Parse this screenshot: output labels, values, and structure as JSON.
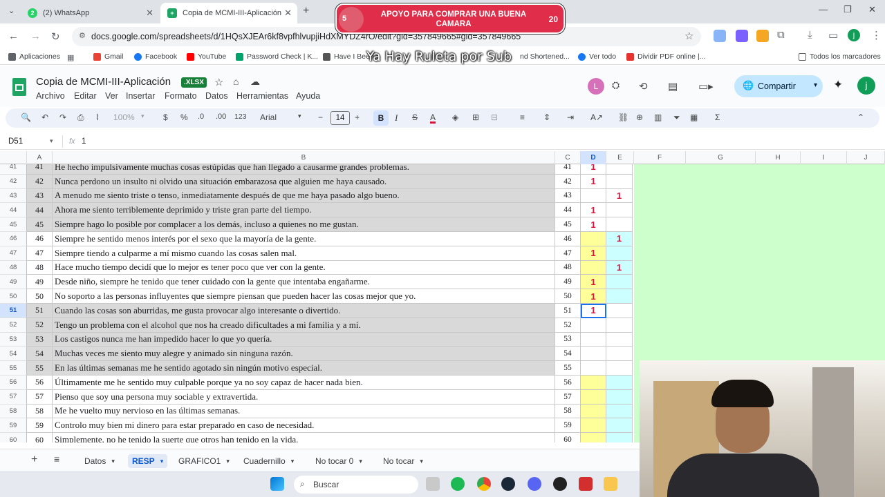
{
  "browser": {
    "tabs": [
      {
        "title": "(2) WhatsApp",
        "badge": "2",
        "active": false
      },
      {
        "title": "Copia de MCMI-III-Aplicación",
        "active": true
      }
    ],
    "url": "docs.google.com/spreadsheets/d/1HQsXJEAr6kf8vpfhlvupjiHdXMYDZ4rO/edit?gid=357849665#gid=357849665",
    "bookmarks": [
      "Aplicaciones",
      "Gmail",
      "Facebook",
      "YouTube",
      "Password Check | K...",
      "Have I Been",
      "Ver todo",
      "Dividir PDF online |...",
      "Todos los marcadores"
    ],
    "bookmark_partial": "nd Shortened..."
  },
  "overlay": {
    "left_number": "5",
    "message": "APOYO PARA COMPRAR UNA BUENA CAMARA",
    "right_number": "20",
    "ruleta_text": "Ya Hay Ruleta por Sub"
  },
  "doc": {
    "title": "Copia de MCMI-III-Aplicación",
    "format_badge": ".XLSX",
    "menus": [
      "Archivo",
      "Editar",
      "Ver",
      "Insertar",
      "Formato",
      "Datos",
      "Herramientas",
      "Ayuda"
    ],
    "share_label": "Compartir",
    "avatar_l": "L",
    "avatar_j": "j"
  },
  "toolbar": {
    "zoom": "100%",
    "currency": "$",
    "percent": "%",
    "dec_less": ".0",
    "dec_more": ".00",
    "number_format": "123",
    "font": "Arial",
    "font_size": "14",
    "bold": "B",
    "italic": "I",
    "strike": "S",
    "text_color": "A",
    "sum": "Σ"
  },
  "formula_bar": {
    "cell_ref": "D51",
    "fx": "fx",
    "value": "1"
  },
  "columns": [
    "A",
    "B",
    "C",
    "D",
    "E",
    "F",
    "G",
    "H",
    "I",
    "J"
  ],
  "rows": [
    {
      "n": "41",
      "a": "41",
      "b": "He hecho impulsivamente muchas cosas estúpidas que han llegado a causarme grandes problemas.",
      "c": "41",
      "d": "1",
      "e": "",
      "shade": true,
      "dbg": "",
      "ebg": ""
    },
    {
      "n": "42",
      "a": "42",
      "b": "Nunca perdono un insulto ni olvido una situación embarazosa que alguien me haya causado.",
      "c": "42",
      "d": "1",
      "e": "",
      "shade": true,
      "dbg": "",
      "ebg": ""
    },
    {
      "n": "43",
      "a": "43",
      "b": "A menudo me siento triste o tenso, inmediatamente después de que me haya pasado algo bueno.",
      "c": "43",
      "d": "",
      "e": "1",
      "shade": true,
      "dbg": "",
      "ebg": ""
    },
    {
      "n": "44",
      "a": "44",
      "b": "Ahora me siento terriblemente deprimido y triste gran parte del tiempo.",
      "c": "44",
      "d": "1",
      "e": "",
      "shade": true,
      "dbg": "",
      "ebg": ""
    },
    {
      "n": "45",
      "a": "45",
      "b": "Siempre hago lo posible por complacer a los demás, incluso a quienes no me gustan.",
      "c": "45",
      "d": "1",
      "e": "",
      "shade": true,
      "dbg": "",
      "ebg": ""
    },
    {
      "n": "46",
      "a": "46",
      "b": "Siempre he sentido menos interés por el sexo que la mayoría de la gente.",
      "c": "46",
      "d": "",
      "e": "1",
      "shade": false,
      "dbg": "yellow",
      "ebg": "cyan"
    },
    {
      "n": "47",
      "a": "47",
      "b": "Siempre tiendo a culparme a mí mismo cuando las cosas salen mal.",
      "c": "47",
      "d": "1",
      "e": "",
      "shade": false,
      "dbg": "yellow",
      "ebg": "cyan"
    },
    {
      "n": "48",
      "a": "48",
      "b": "Hace mucho tiempo decidí que lo mejor es tener poco que ver con la gente.",
      "c": "48",
      "d": "",
      "e": "1",
      "shade": false,
      "dbg": "yellow",
      "ebg": "cyan"
    },
    {
      "n": "49",
      "a": "49",
      "b": "Desde niño, siempre he tenido que tener cuidado con la gente que intentaba engañarme.",
      "c": "49",
      "d": "1",
      "e": "",
      "shade": false,
      "dbg": "yellow",
      "ebg": "cyan"
    },
    {
      "n": "50",
      "a": "50",
      "b": "No soporto a las personas influyentes que siempre piensan que pueden hacer las cosas mejor que yo.",
      "c": "50",
      "d": "1",
      "e": "",
      "shade": false,
      "dbg": "yellow",
      "ebg": "cyan"
    },
    {
      "n": "51",
      "a": "51",
      "b": "Cuando las cosas son aburridas, me gusta provocar algo interesante o divertido.",
      "c": "51",
      "d": "1",
      "e": "",
      "shade": true,
      "dbg": "",
      "ebg": ""
    },
    {
      "n": "52",
      "a": "52",
      "b": "Tengo un problema con el alcohol que nos ha creado dificultades a mi familia y a mí.",
      "c": "52",
      "d": "",
      "e": "",
      "shade": true,
      "dbg": "",
      "ebg": ""
    },
    {
      "n": "53",
      "a": "53",
      "b": "Los castigos nunca me han impedido hacer lo que yo quería.",
      "c": "53",
      "d": "",
      "e": "",
      "shade": true,
      "dbg": "",
      "ebg": ""
    },
    {
      "n": "54",
      "a": "54",
      "b": "Muchas veces me siento muy alegre y animado sin ninguna razón.",
      "c": "54",
      "d": "",
      "e": "",
      "shade": true,
      "dbg": "",
      "ebg": ""
    },
    {
      "n": "55",
      "a": "55",
      "b": "En las últimas semanas me he sentido agotado sin ningún motivo especial.",
      "c": "55",
      "d": "",
      "e": "",
      "shade": true,
      "dbg": "",
      "ebg": ""
    },
    {
      "n": "56",
      "a": "56",
      "b": "Últimamente me he sentido muy culpable porque ya no soy capaz de hacer nada bien.",
      "c": "56",
      "d": "",
      "e": "",
      "shade": false,
      "dbg": "yellow",
      "ebg": "cyan"
    },
    {
      "n": "57",
      "a": "57",
      "b": "Pienso que soy una persona muy sociable y extravertida.",
      "c": "57",
      "d": "",
      "e": "",
      "shade": false,
      "dbg": "yellow",
      "ebg": "cyan"
    },
    {
      "n": "58",
      "a": "58",
      "b": "Me he vuelto muy nervioso en las últimas semanas.",
      "c": "58",
      "d": "",
      "e": "",
      "shade": false,
      "dbg": "yellow",
      "ebg": "cyan"
    },
    {
      "n": "59",
      "a": "59",
      "b": "Controlo muy bien mi dinero para estar preparado en caso de necesidad.",
      "c": "59",
      "d": "",
      "e": "",
      "shade": false,
      "dbg": "yellow",
      "ebg": "cyan"
    },
    {
      "n": "60",
      "a": "60",
      "b": "Simplemente, no he tenido la suerte que otros han tenido en la vida.",
      "c": "60",
      "d": "",
      "e": "",
      "shade": false,
      "dbg": "yellow",
      "ebg": "cyan"
    }
  ],
  "selected_row": "51",
  "sheet_tabs": [
    {
      "label": "Datos",
      "active": false
    },
    {
      "label": "RESP",
      "active": true
    },
    {
      "label": "GRAFICO1",
      "active": false
    },
    {
      "label": "Cuadernillo",
      "active": false
    },
    {
      "label": "No tocar 0",
      "active": false
    },
    {
      "label": "No tocar",
      "active": false
    }
  ],
  "taskbar": {
    "search_placeholder": "Buscar"
  }
}
